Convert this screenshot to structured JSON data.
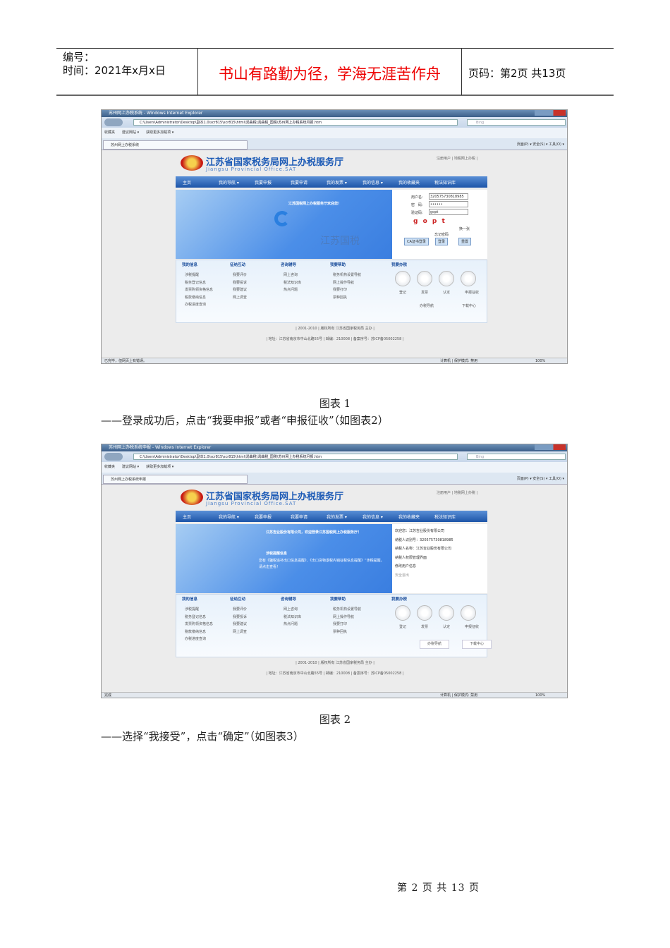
{
  "header": {
    "number_label": "编号：",
    "time_label": "时间：2021年x月x日",
    "motto": "书山有路勤为径，学海无涯苦作舟",
    "page_label": "页码：第2页 共13页"
  },
  "common": {
    "address": "C:\\Users\\Administrator\\Desktop\\副本1.0\\scr815\\scr815\\html\\涡曲税\\涡曲税_国税\\苏州网上办税系统月报.htm",
    "bing": "Bing",
    "favorites": "收藏夹",
    "suggested": "建议网站 ▾",
    "more_addons": "获取更多加载项 ▾",
    "cmdbar": "页面(P) ▾  安全(S) ▾  工具(O) ▾",
    "site_title": "江苏省国家税务局网上办税服务厅",
    "site_en": "Jiangsu Provincial Office.SAT",
    "register": "注册用户 | 地税网上办税 |",
    "nav": [
      "主页",
      "我的导航 ▾",
      "我要申报",
      "我要申请",
      "我的发票 ▾",
      "我的信息 ▾",
      "我的收藏夹",
      "税法知识库"
    ],
    "sections": [
      {
        "title": "我的信息",
        "items": [
          "涉税提醒",
          "税务登记信息",
          "发票购领资格信息",
          "税款缴纳信息",
          "办税进度查询"
        ]
      },
      {
        "title": "征纳互动",
        "items": [
          "我要评价",
          "我要投诉",
          "我要建议",
          "网上调查"
        ]
      },
      {
        "title": "咨询辅导",
        "items": [
          "网上咨询",
          "税法知识库",
          "热点问题",
          ""
        ]
      },
      {
        "title": "我要帮助",
        "items": [
          "税务机构设置导航",
          "网上操作导航",
          "我要打印",
          "票种回执"
        ]
      },
      {
        "title": "我要办税",
        "items": [
          "登记",
          "发票",
          "认定",
          "申报征收"
        ]
      }
    ],
    "footer1": "| 2001-2010 | 版权所有 江苏省国家税务局 主办 |",
    "footer2": "| 地址：江苏省南京市中山北路55号 | 邮编：210008 | 备案序号：苏ICP备05002258 |",
    "status_zone": "计算机 | 保护模式: 禁用",
    "zoom": "100%"
  },
  "shot1": {
    "window_title": "苏州网上办税系统 - Windows Internet Explorer",
    "tab": "苏州网上办税系统",
    "welcome": "江苏国税网上办税服务厅欢迎您！",
    "brand": "江苏国税",
    "username_label": "用户名:",
    "username": "320575730818985",
    "password_label": "密　码:",
    "password": "••••••",
    "captcha_label": "验证码:",
    "captcha_value": "gopt",
    "captcha_image": "g o p t",
    "refresh": "换一张",
    "forgot": "忘记密码",
    "ca_login": "CA证书登录",
    "login": "登录",
    "reset": "重置",
    "guide": "办税导航",
    "download": "下载中心",
    "status": "已完毕，但网页上有错误。"
  },
  "shot2": {
    "window_title": "苏州网上办税系统申报 - Windows Internet Explorer",
    "tab": "苏州网上办税系统申报",
    "welcome": "江苏吉业股份有限公司，欢迎登录江苏国税网上办税服务厅！",
    "reminder_title": "涉税提醒信息",
    "reminder_text": "您有《骗税追补出口信息提醒》、《出口货物退税内销征税信息提醒》“涉税提醒，请点击查看！",
    "info": [
      "欢迎您：江苏吉业股份有限公司",
      "纳税人识别号：320575730818985",
      "纳税人名称：江苏吉业股份有限公司",
      "纳税人权限管理界面",
      "修改用户信息",
      "安全退出"
    ],
    "guide": "办税导航",
    "download": "下载中心",
    "status": "完成"
  },
  "captions": {
    "fig1": "图表 1",
    "line1": "——登录成功后，点击“我要申报”或者“申报征收”（如图表2）",
    "fig2": "图表 2",
    "line2": "——选择“我接受”，点击“确定”（如图表3）"
  },
  "footer": "第 2 页 共 13 页"
}
